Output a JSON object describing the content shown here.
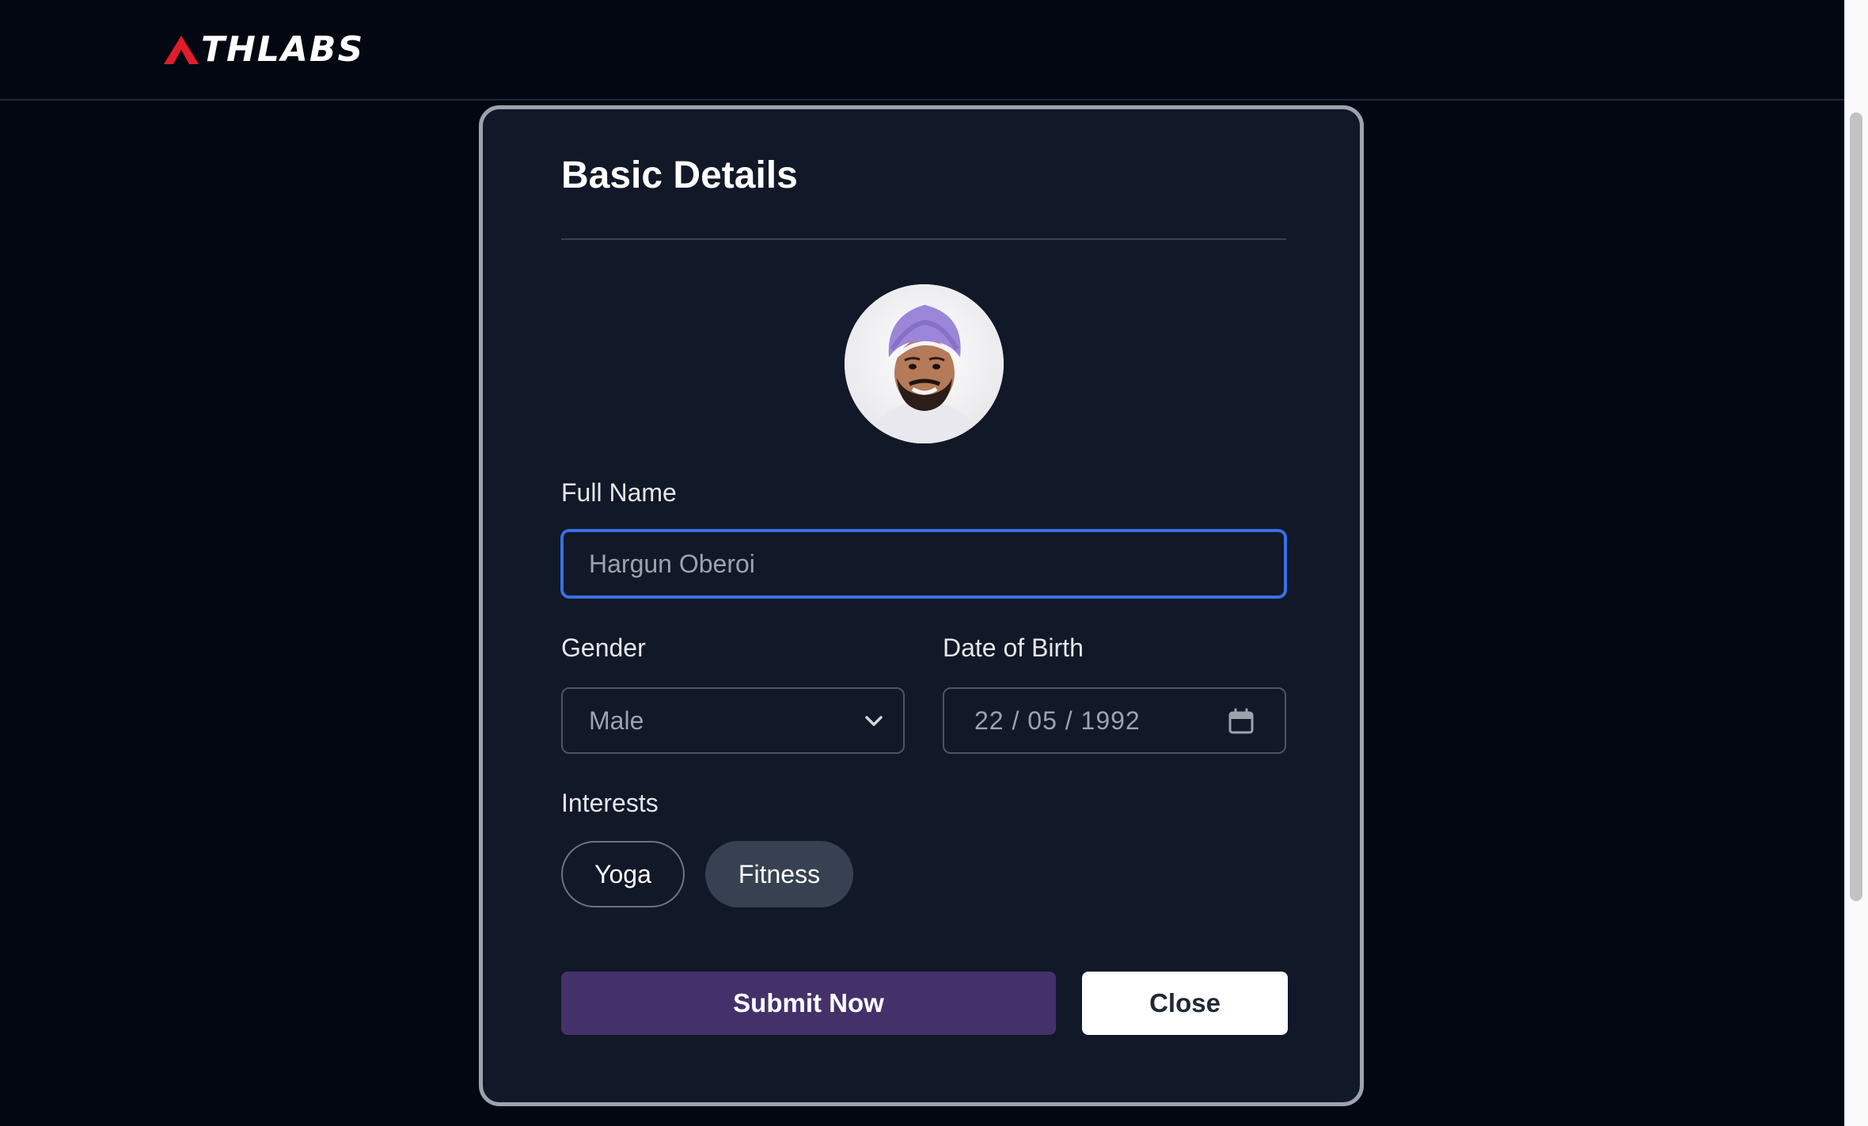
{
  "header": {
    "logo_text": "THLABS",
    "logo_full": "ATHLABS",
    "brand_color": "#e11d2a"
  },
  "modal": {
    "title": "Basic Details",
    "avatar": {
      "icon": "profile-photo",
      "alt": "profile photo"
    },
    "full_name": {
      "label": "Full Name",
      "value": "Hargun Oberoi"
    },
    "gender": {
      "label": "Gender",
      "value": "Male",
      "icon": "chevron-down-icon"
    },
    "dob": {
      "label": "Date of Birth",
      "value": "22 / 05 / 1992",
      "icon": "calendar-icon"
    },
    "interests": {
      "label": "Interests",
      "chips": [
        {
          "label": "Yoga",
          "selected": false
        },
        {
          "label": "Fitness",
          "selected": true
        }
      ]
    },
    "actions": {
      "submit_label": "Submit Now",
      "close_label": "Close",
      "submit_color": "#44316a",
      "focus_color": "#3b6fe6"
    }
  }
}
